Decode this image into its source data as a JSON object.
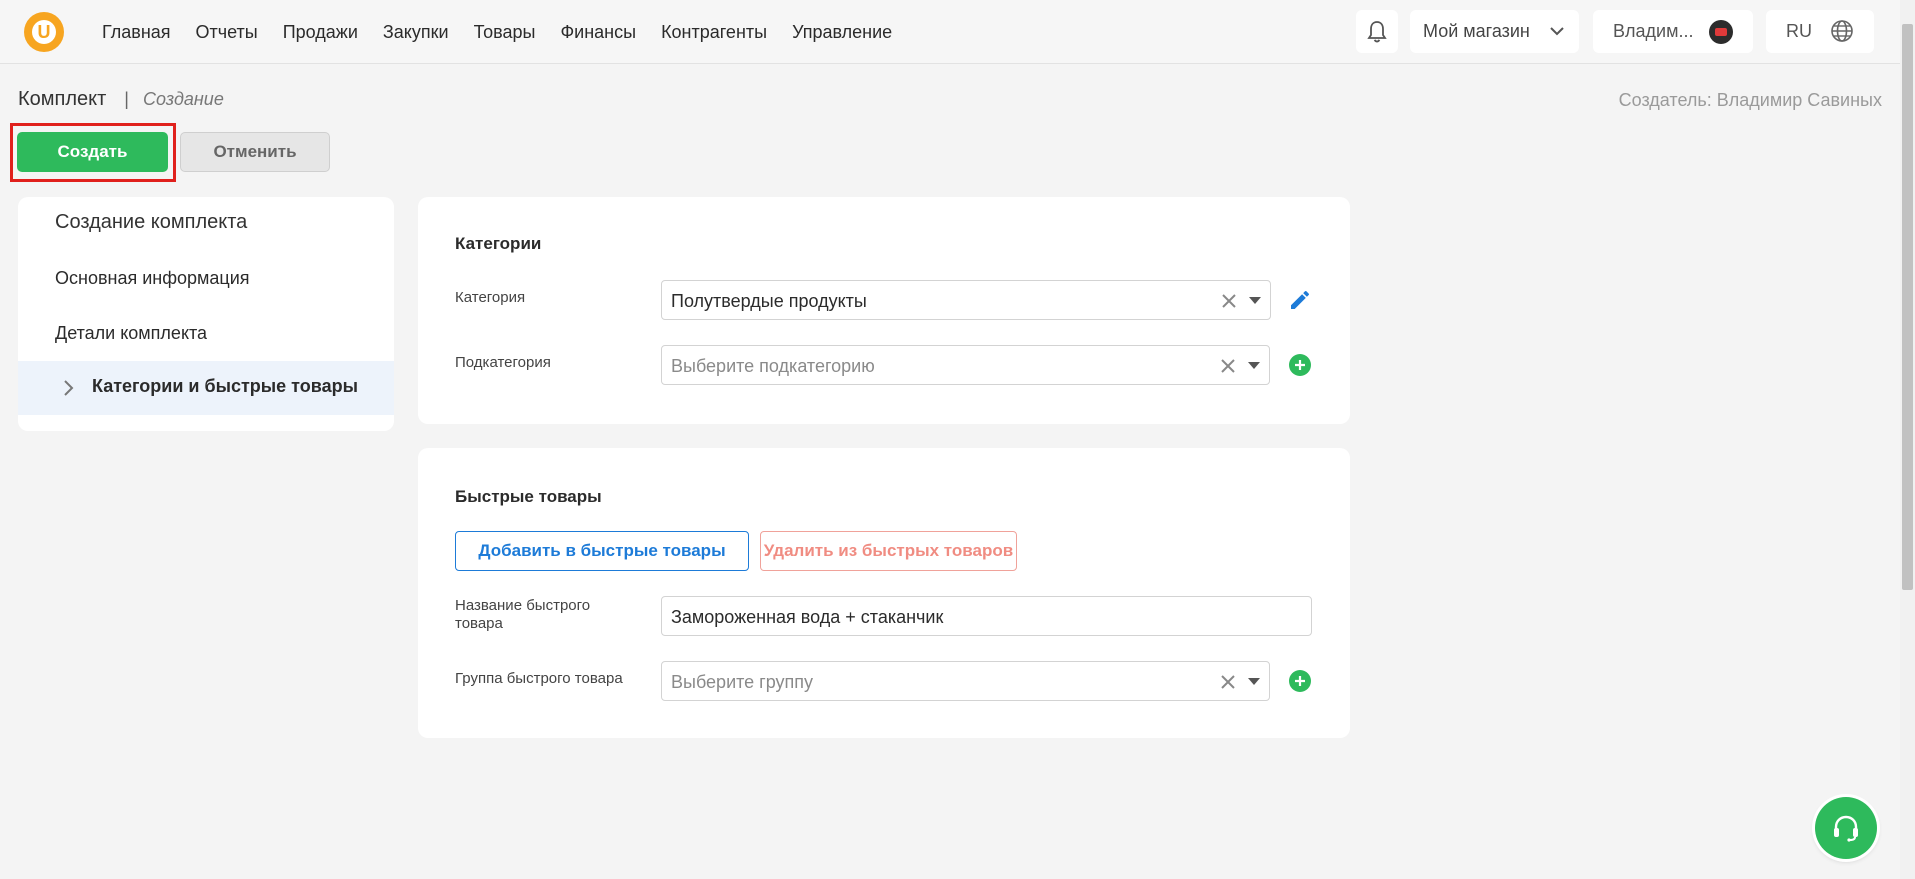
{
  "header": {
    "logo_letter": "U",
    "nav": [
      "Главная",
      "Отчеты",
      "Продажи",
      "Закупки",
      "Товары",
      "Финансы",
      "Контрагенты",
      "Управление"
    ],
    "shop": "Мой магазин",
    "user": "Владим...",
    "lang": "RU"
  },
  "breadcrumb": {
    "title": "Комплект",
    "separator": "|",
    "sub": "Создание"
  },
  "creator": "Создатель: Владимир Савиных",
  "actions": {
    "create": "Создать",
    "cancel": "Отменить"
  },
  "side_menu": {
    "title": "Создание комплекта",
    "items": [
      "Основная информация",
      "Детали комплекта",
      "Категории и быстрые товары"
    ]
  },
  "categories": {
    "title": "Категории",
    "category_label": "Категория",
    "category_value": "Полутвердые продукты",
    "subcategory_label": "Подкатегория",
    "subcategory_placeholder": "Выберите подкатегорию"
  },
  "quick": {
    "title": "Быстрые товары",
    "add_button": "Добавить в быстрые товары",
    "remove_button": "Удалить из быстрых товаров",
    "name_label": "Название быстрого товара",
    "name_value": "Замороженная вода + стаканчик",
    "group_label": "Группа быстрого товара",
    "group_placeholder": "Выберите группу"
  },
  "colors": {
    "accent_green": "#2eba5c",
    "accent_blue": "#1d7bd8",
    "highlight_red": "#e0201c",
    "logo_orange": "#f7a520"
  }
}
